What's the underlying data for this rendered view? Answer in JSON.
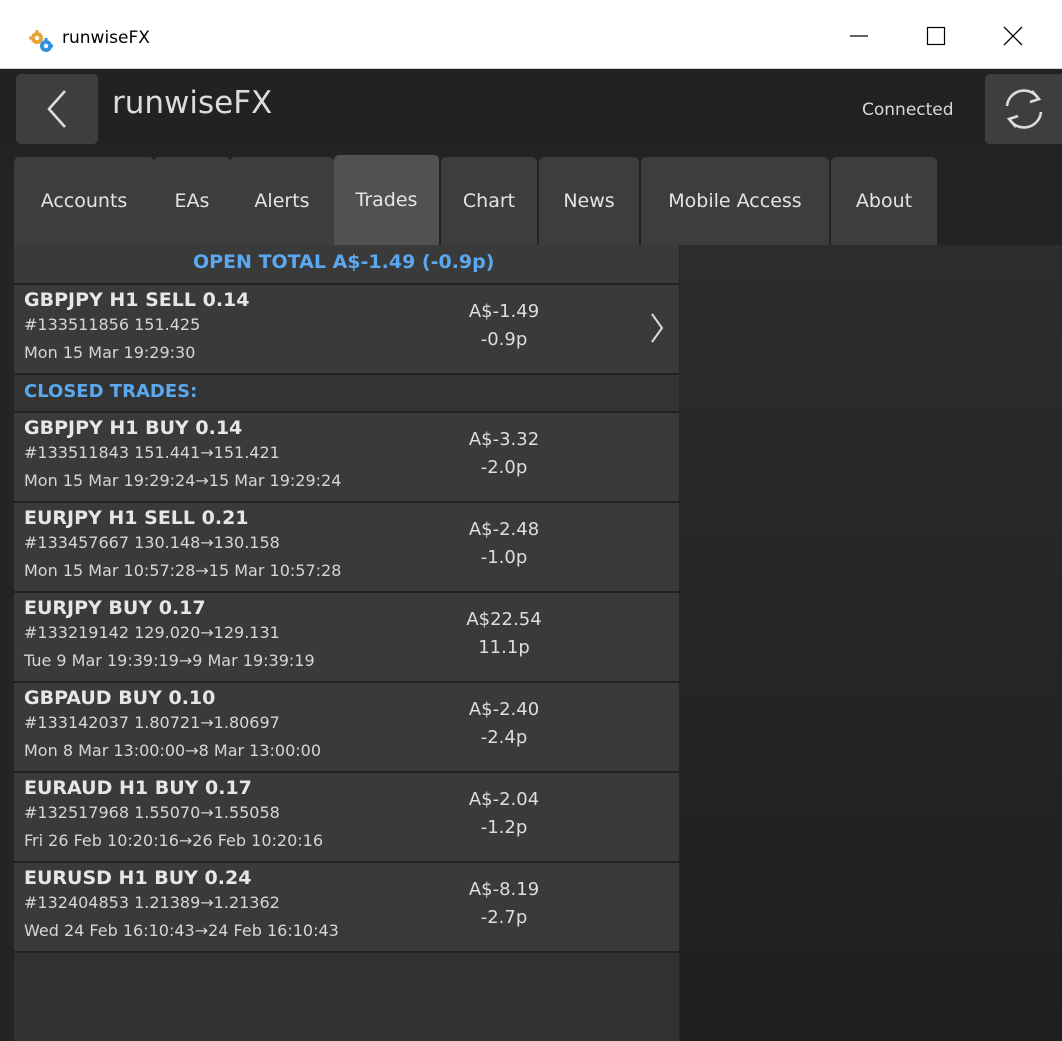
{
  "window": {
    "title": "runwiseFX"
  },
  "header": {
    "title": "runwiseFX",
    "status": "Connected"
  },
  "tabs": [
    {
      "label": "Accounts"
    },
    {
      "label": "EAs"
    },
    {
      "label": "Alerts"
    },
    {
      "label": "Trades",
      "active": true
    },
    {
      "label": "Chart"
    },
    {
      "label": "News"
    },
    {
      "label": "Mobile Access"
    },
    {
      "label": "About"
    }
  ],
  "trades": {
    "open_total": "OPEN TOTAL A$-1.49 (-0.9p)",
    "open": [
      {
        "title": "GBPJPY H1 SELL 0.14",
        "details": "#133511856  151.425",
        "time": "Mon 15 Mar 19:29:30",
        "pl": "A$-1.49",
        "pips": "-0.9p"
      }
    ],
    "closed_header": "CLOSED TRADES:",
    "closed": [
      {
        "title": "GBPJPY H1 BUY 0.14",
        "details": "#133511843  151.441→151.421",
        "time": "Mon 15 Mar 19:29:24→15 Mar 19:29:24",
        "pl": "A$-3.32",
        "pips": "-2.0p"
      },
      {
        "title": "EURJPY H1 SELL 0.21",
        "details": "#133457667  130.148→130.158",
        "time": "Mon 15 Mar 10:57:28→15 Mar 10:57:28",
        "pl": "A$-2.48",
        "pips": "-1.0p"
      },
      {
        "title": "EURJPY BUY 0.17",
        "details": "#133219142  129.020→129.131",
        "time": "Tue 9 Mar 19:39:19→9 Mar 19:39:19",
        "pl": "A$22.54",
        "pips": "11.1p"
      },
      {
        "title": "GBPAUD BUY 0.10",
        "details": "#133142037  1.80721→1.80697",
        "time": "Mon 8 Mar 13:00:00→8 Mar 13:00:00",
        "pl": "A$-2.40",
        "pips": "-2.4p"
      },
      {
        "title": "EURAUD H1 BUY 0.17",
        "details": "#132517968  1.55070→1.55058",
        "time": "Fri 26 Feb 10:20:16→26 Feb 10:20:16",
        "pl": "A$-2.04",
        "pips": "-1.2p"
      },
      {
        "title": "EURUSD H1 BUY 0.24",
        "details": "#132404853  1.21389→1.21362",
        "time": "Wed 24 Feb 16:10:43→24 Feb 16:10:43",
        "pl": "A$-8.19",
        "pips": "-2.7p"
      }
    ]
  },
  "icons": {
    "app": "gears-icon",
    "back": "chevron-left-icon",
    "refresh": "refresh-icon",
    "open_trade_detail": "chevron-right-icon",
    "minimize": "minimize-icon",
    "maximize": "maximize-icon",
    "close": "close-icon"
  },
  "colors": {
    "accent": "#5aa8f0",
    "header_bg": "#222222",
    "panel_bg": "#3a3a3a"
  }
}
